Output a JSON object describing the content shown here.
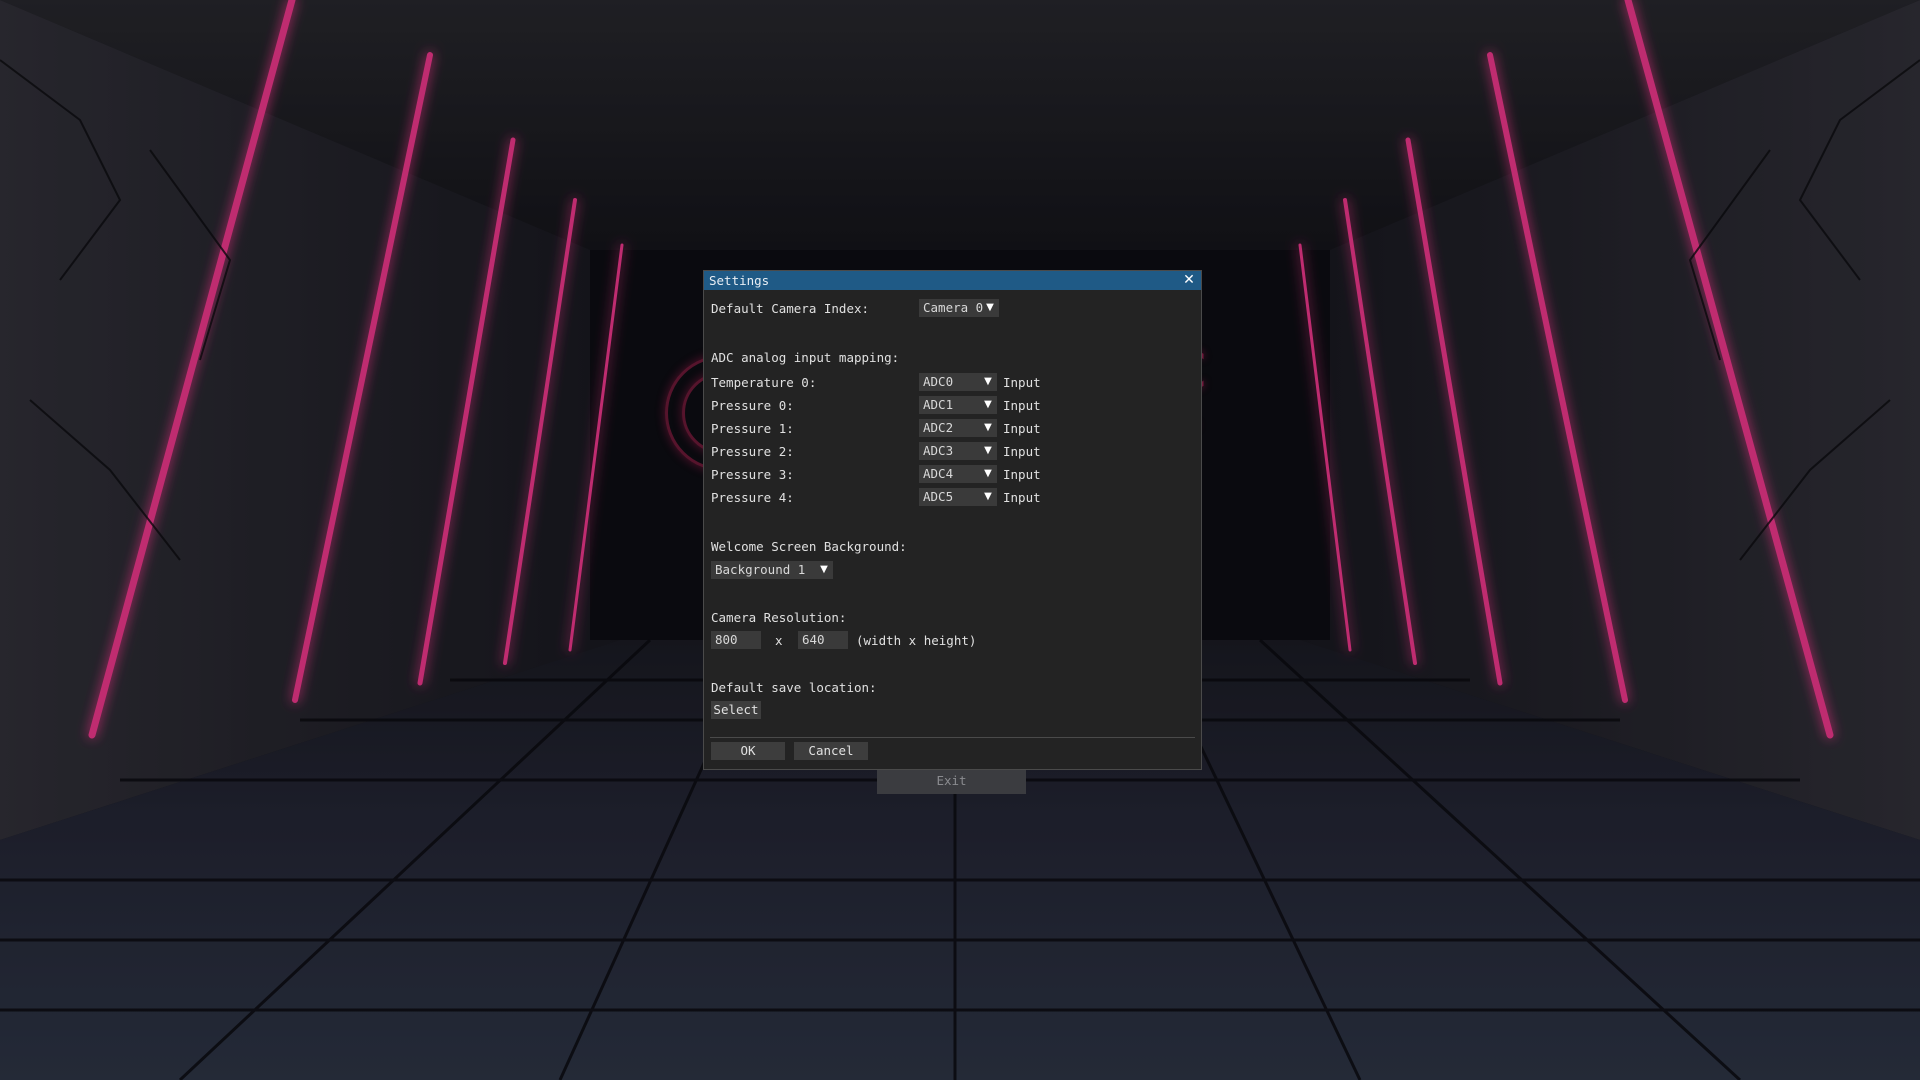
{
  "main": {
    "exit_label": "Exit"
  },
  "dialog": {
    "title": "Settings",
    "close_icon": "close-icon",
    "camera_index": {
      "label": "Default Camera Index:",
      "value": "Camera 0"
    },
    "adc": {
      "heading": "ADC analog input mapping:",
      "rows": [
        {
          "label": "Temperature 0:",
          "value": "ADC0",
          "suffix": "Input"
        },
        {
          "label": "Pressure 0:",
          "value": "ADC1",
          "suffix": "Input"
        },
        {
          "label": "Pressure 1:",
          "value": "ADC2",
          "suffix": "Input"
        },
        {
          "label": "Pressure 2:",
          "value": "ADC3",
          "suffix": "Input"
        },
        {
          "label": "Pressure 3:",
          "value": "ADC4",
          "suffix": "Input"
        },
        {
          "label": "Pressure 4:",
          "value": "ADC5",
          "suffix": "Input"
        }
      ]
    },
    "background": {
      "heading": "Welcome Screen Background:",
      "value": "Background 1"
    },
    "resolution": {
      "heading": "Camera Resolution:",
      "width": "800",
      "separator": "x",
      "height": "640",
      "hint": "(width x height)"
    },
    "save": {
      "heading": "Default save location:",
      "button": "Select"
    },
    "ok_label": "OK",
    "cancel_label": "Cancel"
  },
  "colors": {
    "titlebar": "#1f5a86",
    "dialog_bg": "#232323",
    "widget_bg": "#3a3a3a",
    "neon": "#ff2a8a"
  }
}
